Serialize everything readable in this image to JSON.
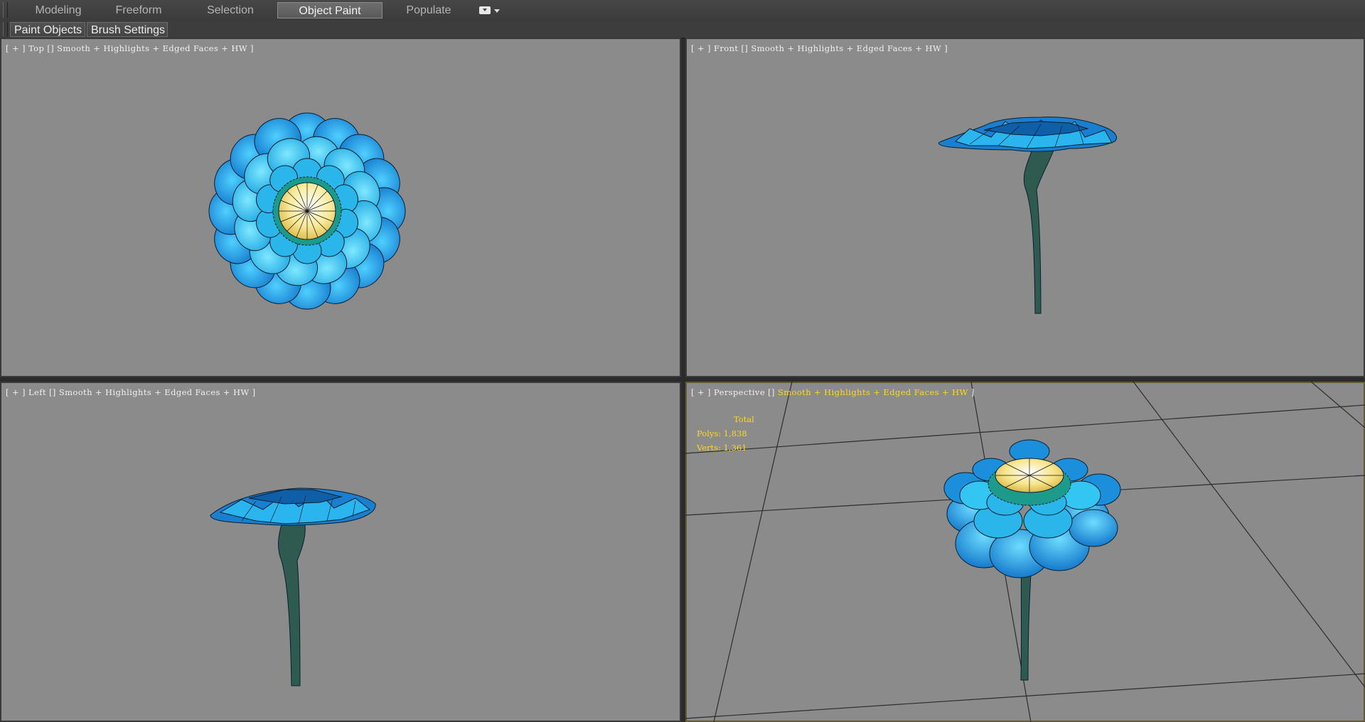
{
  "ribbon": {
    "tabs": [
      {
        "label": "Modeling",
        "active": false
      },
      {
        "label": "Freeform",
        "active": false
      },
      {
        "label": "Selection",
        "active": false
      },
      {
        "label": "Object Paint",
        "active": true
      },
      {
        "label": "Populate",
        "active": false
      }
    ],
    "panel_buttons": [
      "Paint Objects",
      "Brush Settings"
    ]
  },
  "viewports": {
    "top": {
      "view": "Top",
      "shading": "Smooth + Highlights + Edged Faces + HW"
    },
    "front": {
      "view": "Front",
      "shading": "Smooth + Highlights + Edged Faces + HW"
    },
    "left": {
      "view": "Left",
      "shading": "Smooth + Highlights + Edged Faces + HW"
    },
    "perspective": {
      "view": "Perspective",
      "shading": "Smooth + Highlights + Edged Faces + HW",
      "stats": {
        "title": "Total",
        "polys": "Polys: 1,838",
        "verts": "Verts: 1,361"
      }
    }
  },
  "colors": {
    "viewport_bg": "#8b8b8b",
    "petal_blue": "#1e8fe0",
    "petal_cyan": "#33c6f2",
    "center_yellow": "#f7e48a",
    "stem_green": "#2f5a4f",
    "label_yellow": "#ffd81a"
  }
}
